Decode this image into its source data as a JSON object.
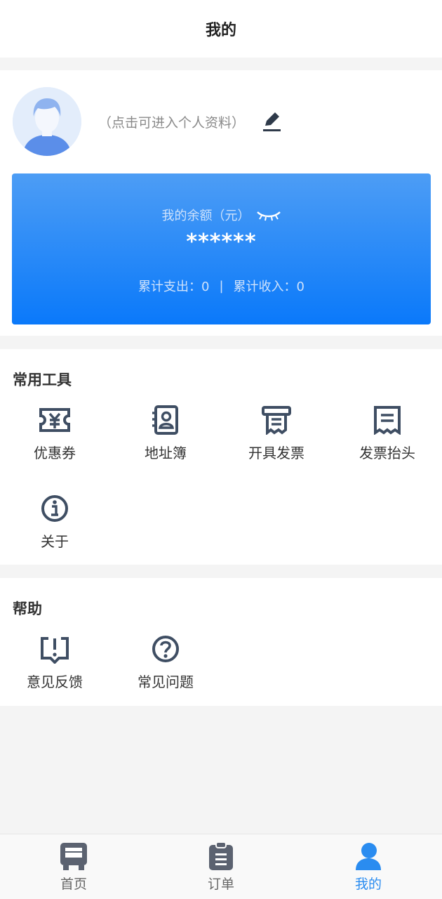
{
  "header": {
    "title": "我的"
  },
  "profile": {
    "hint": "（点击可进入个人资料）"
  },
  "balance": {
    "label": "我的余额（元）",
    "value": "******",
    "expense_text": "累计支出：0",
    "divider": "|",
    "income_text": "累计收入：0"
  },
  "tools": {
    "title": "常用工具",
    "items": [
      {
        "label": "优惠券",
        "icon": "coupon-icon"
      },
      {
        "label": "地址簿",
        "icon": "address-book-icon"
      },
      {
        "label": "开具发票",
        "icon": "issue-invoice-icon"
      },
      {
        "label": "发票抬头",
        "icon": "invoice-header-icon"
      },
      {
        "label": "关于",
        "icon": "info-icon"
      }
    ]
  },
  "help": {
    "title": "帮助",
    "items": [
      {
        "label": "意见反馈",
        "icon": "feedback-icon"
      },
      {
        "label": "常见问题",
        "icon": "question-icon"
      }
    ]
  },
  "tabbar": {
    "items": [
      {
        "label": "首页",
        "icon": "home-icon"
      },
      {
        "label": "订单",
        "icon": "orders-icon"
      },
      {
        "label": "我的",
        "icon": "profile-icon",
        "active": true
      }
    ]
  },
  "colors": {
    "accent": "#2a8cf0",
    "card_top": "#4d9df5",
    "card_bottom": "#0a79fa",
    "icon": "#3f4e63"
  }
}
